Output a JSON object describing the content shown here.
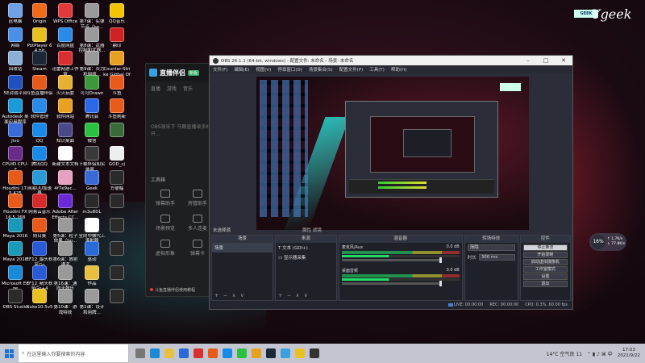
{
  "desktop": {
    "icons": [
      {
        "label": "此电脑",
        "color": "#6fa0e8"
      },
      {
        "label": "Origin",
        "color": "#f06a1a"
      },
      {
        "label": "WPS Office",
        "color": "#e23a3a"
      },
      {
        "label": "第7课：实弹节点（bo...",
        "color": "#9a9a9a"
      },
      {
        "label": "QQ音乐",
        "color": "#f5c400"
      },
      {
        "label": "网络",
        "color": "#4a8fe8"
      },
      {
        "label": "PotPlayer 64 bit",
        "color": "#e8c020"
      },
      {
        "label": "百度网盘",
        "color": "#2a8ae8"
      },
      {
        "label": "第8课：武器控制和武器...",
        "color": "#9a9a9a"
      },
      {
        "label": "鼎印",
        "color": "#cc2222"
      },
      {
        "label": "回收站",
        "color": "#8ab0d8"
      },
      {
        "label": "Steam",
        "color": "#1b2838"
      },
      {
        "label": "迅雷网游工作室",
        "color": "#d83030"
      },
      {
        "label": "第9课：兵力和网络...",
        "color": "#9a9a9a"
      },
      {
        "label": "Counter-Strike Global Off...",
        "color": "#e8a020"
      },
      {
        "label": "5E对战平台",
        "color": "#2050c0"
      },
      {
        "label": "斗鱼直播伴侣",
        "color": "#e85a1a"
      },
      {
        "label": "火火玩耍",
        "color": "#e8b030"
      },
      {
        "label": "可可Drawn",
        "color": "#3a9a3a"
      },
      {
        "label": "斗鱼",
        "color": "#e85a1a"
      },
      {
        "label": "Autodesk 桌面应用程序",
        "color": "#1a9ad8"
      },
      {
        "label": "软件管理",
        "color": "#2a8ae8"
      },
      {
        "label": "软件网站",
        "color": "#e8a020"
      },
      {
        "label": "腾讯会",
        "color": "#2a6ae8"
      },
      {
        "label": "斗鱼刷新",
        "color": "#e85a1a"
      },
      {
        "label": "Jivo",
        "color": "#3a6ad8"
      },
      {
        "label": "QQ",
        "color": "#1a8ae8"
      },
      {
        "label": "知识桌面",
        "color": "#4a4a8a"
      },
      {
        "label": "微信",
        "color": "#2ac040"
      },
      {
        "label": "",
        "color": "#3a6a3a"
      },
      {
        "label": "CPUID CPU-Z",
        "color": "#6a2a8a"
      },
      {
        "label": "腾讯QQ",
        "color": "#1a8ae8"
      },
      {
        "label": "新建文本文档",
        "color": "#ffffff"
      },
      {
        "label": "下载伴侣和实地原...",
        "color": "#3a3a3a"
      },
      {
        "label": "GOD_cj",
        "color": "#eeeeee"
      },
      {
        "label": "Houdini 17.5.425",
        "color": "#e85a1a"
      },
      {
        "label": "网易UU加速器",
        "color": "#2a9ad8"
      },
      {
        "label": "4f7e9ac...",
        "color": "#e8a0c0"
      },
      {
        "label": "Geek",
        "color": "#3a6ad8"
      },
      {
        "label": "方便幅",
        "color": "#2a2a2a"
      },
      {
        "label": "Houdini FX 16.5.268",
        "color": "#e85a1a"
      },
      {
        "label": "网易云音乐",
        "color": "#d82a2a"
      },
      {
        "label": "Adobe After Effects CC...",
        "color": "#6a2ad8"
      },
      {
        "label": "m3u8DL",
        "color": "#2a2a2a"
      },
      {
        "label": "",
        "color": "#2a2a2a"
      },
      {
        "label": "Maya 2016",
        "color": "#1a9ab8"
      },
      {
        "label": "向日葵",
        "color": "#e85a1a"
      },
      {
        "label": "第5课：粒子效果（bo...",
        "color": "#9a9a9a"
      },
      {
        "label": "全向中做代工滚射器",
        "color": "#ffffff"
      },
      {
        "label": "",
        "color": "#2a2a2a"
      },
      {
        "label": "Maya 2018",
        "color": "#1a9ab8"
      },
      {
        "label": "EF12_最头秋至Go",
        "color": "#2a5ad8"
      },
      {
        "label": "第6课：放射通道",
        "color": "#9a9a9a"
      },
      {
        "label": "驱动",
        "color": "#2a6ad8"
      },
      {
        "label": "",
        "color": "#2a2a2a"
      },
      {
        "label": "Microsoft Edge",
        "color": "#1a8ad8"
      },
      {
        "label": "EF12_精头秋至Go+4",
        "color": "#2a5ad8"
      },
      {
        "label": "第16课：通向天鼓乐",
        "color": "#9a9a9a"
      },
      {
        "label": "作品",
        "color": "#e8c040"
      },
      {
        "label": "",
        "color": "#2a2a2a"
      },
      {
        "label": "OBS Studio",
        "color": "#2a2a2a"
      },
      {
        "label": "Nuke10.5v5",
        "color": "#e8c020"
      },
      {
        "label": "第10课：游戏特效",
        "color": "#9a9a9a"
      },
      {
        "label": "第1课：设计和用牌...",
        "color": "#9a9a9a"
      },
      {
        "label": "",
        "color": "#2a2a2a"
      }
    ]
  },
  "logo": {
    "box": "GEEK",
    "signature": "Ygeek"
  },
  "helper": {
    "title": "直播伴侣",
    "tag": "新版",
    "nav": [
      "直播",
      "游戏",
      "音乐"
    ],
    "notice": "OBS源采下 马跟直播录多好开...",
    "section": "工具箱",
    "tools": [
      "弹幕助手",
      "房管助手",
      "场景预览",
      "多人连麦",
      "虚拟形象",
      "弹幕卡",
      "自定义",
      " "
    ],
    "footer": "斗鱼直播伴侣使用教程"
  },
  "obs": {
    "title": "OBS 26.1.1 (64-bit, windows) - 配置文件: 未命名 - 场景: 未命名",
    "menu": [
      "文件(F)",
      "编辑(E)",
      "视图(V)",
      "停靠窗口(D)",
      "场景集合(S)",
      "配置文件(P)",
      "工具(T)",
      "帮助(H)"
    ],
    "sceneTop": "未选择源",
    "filterTop": "属性    滤镜",
    "docks": {
      "scenes_title": "场景",
      "scene": "场景",
      "sources_title": "来源",
      "sources": [
        "文本 (GDI+)",
        "显示器采集"
      ],
      "mixer_title": "混音器",
      "mixer": [
        {
          "name": "麦克风/Aux",
          "db": "0.0 dB"
        },
        {
          "name": "桌面音频",
          "db": "0.0 dB"
        }
      ],
      "trans_title": "转场特效",
      "trans_type": "渐隐",
      "trans_label": "时长",
      "trans_dur": "300 ms",
      "ctrl_title": "控件",
      "controls": [
        "停止推流",
        "开始录制",
        "启动虚拟摄像机",
        "工作室模式",
        "设置",
        "退出"
      ],
      "btns": "+ − ∧ ∨"
    },
    "status": [
      "LIVE: 00:00:00",
      "REC: 00:00:00",
      "CPU: 0.3%, 60.00 fps"
    ]
  },
  "widget": {
    "pct": "16%",
    "up": "1.7K/s",
    "down": "77.8K/s"
  },
  "taskbar": {
    "search": "在这里输入你要搜索的内容",
    "weather": "14°C 空气良 11",
    "time": "17:03",
    "date": "2021/9/22"
  }
}
